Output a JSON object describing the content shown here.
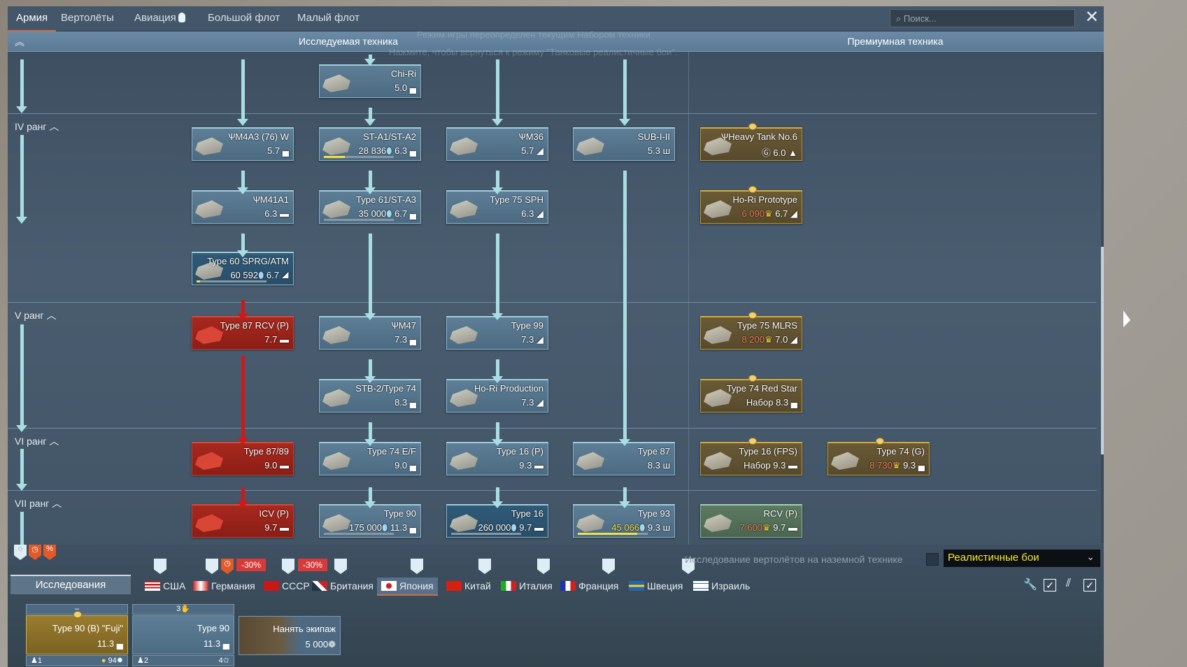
{
  "top_tabs": [
    "Армия",
    "Вертолёты",
    "Авиация",
    "Большой флот",
    "Малый флот"
  ],
  "search": {
    "placeholder": "Поиск..."
  },
  "header": {
    "researched": "Исследуемая техника",
    "premium": "Премиумная техника"
  },
  "notice": {
    "line1": "Режим игры переопределен текущим Набором техники.",
    "line2": "Нажмите, чтобы вернуться к режиму \"Танковые реалистичные бои\"."
  },
  "ranks": [
    "IV ранг",
    "V ранг",
    "VI ранг",
    "VII ранг"
  ],
  "vehicles": [
    {
      "name": "Chi-Ri",
      "br": "5.0",
      "type": "▄",
      "style": "normal"
    },
    {
      "name": "ѰM4A3 (76) W",
      "br": "5.7",
      "type": "▄",
      "style": "normal"
    },
    {
      "name": "ST-A1/ST-A2",
      "cost": "28 836",
      "br": "6.3",
      "type": "▄",
      "style": "normal",
      "progress": 0.3
    },
    {
      "name": "ѰM36",
      "br": "5.7",
      "type": "◢",
      "style": "normal"
    },
    {
      "name": "SUB-I-II",
      "br": "5.3",
      "type": "ш",
      "style": "normal"
    },
    {
      "name": "ѰM41A1",
      "br": "6.3",
      "type": "▬",
      "style": "normal"
    },
    {
      "name": "Type 61/ST-A3",
      "cost": "35 000",
      "br": "6.7",
      "type": "▄",
      "style": "normal",
      "progress": 0
    },
    {
      "name": "Type 75 SPH",
      "br": "6.3",
      "type": "◢",
      "style": "normal"
    },
    {
      "name": "Type 60 SPRG/ATM",
      "cost": "60 592",
      "br": "6.7",
      "type": "◢",
      "style": "sel",
      "progress": 0.05
    },
    {
      "name": "Type 87 RCV (P)",
      "br": "7.7",
      "type": "▬",
      "style": "red"
    },
    {
      "name": "ѰM47",
      "br": "7.3",
      "type": "▄",
      "style": "normal"
    },
    {
      "name": "Type 99",
      "br": "7.3",
      "type": "◢",
      "style": "normal"
    },
    {
      "name": "STB-2/Type 74",
      "br": "8.3",
      "type": "▄",
      "style": "normal"
    },
    {
      "name": "Ho-Ri Production",
      "br": "7.3",
      "type": "◢",
      "style": "normal"
    },
    {
      "name": "Type 87/89",
      "br": "9.0",
      "type": "▬",
      "style": "red"
    },
    {
      "name": "Type 74 E/F",
      "br": "9.0",
      "type": "▄",
      "style": "normal"
    },
    {
      "name": "Type 16 (P)",
      "br": "9.3",
      "type": "▬",
      "style": "normal"
    },
    {
      "name": "Type 87",
      "br": "8.3",
      "type": "ш",
      "style": "normal"
    },
    {
      "name": "ICV (P)",
      "br": "9.7",
      "type": "▬",
      "style": "red"
    },
    {
      "name": "Type 90",
      "cost": "175 000",
      "br": "11.3",
      "type": "▄",
      "style": "normal",
      "progress": 0
    },
    {
      "name": "Type 16",
      "cost": "260 000",
      "br": "9.7",
      "type": "▬",
      "style": "sel",
      "progress": 0
    },
    {
      "name": "Type 93",
      "cost": "45 066",
      "br": "9.3",
      "type": "ш",
      "style": "normal",
      "cost_color": "y",
      "progress": 0.85
    },
    {
      "name": "ѰHeavy Tank No.6",
      "cost": "Ⓖ",
      "br": "6.0",
      "type": "▲",
      "style": "prem"
    },
    {
      "name": "Ho-Ri Prototype",
      "cost": "6 090",
      "br": "6.7",
      "type": "◢",
      "style": "prem",
      "cost_color": "pc"
    },
    {
      "name": "Type 75 MLRS",
      "cost": "8 200",
      "br": "7.0",
      "type": "◢",
      "style": "prem",
      "cost_color": "pc"
    },
    {
      "name": "Type 74 Red Star",
      "cost": "Набор",
      "br": "8.3",
      "type": "▄",
      "style": "prem"
    },
    {
      "name": "Type 16 (FPS)",
      "cost": "Набор",
      "br": "9.3",
      "type": "▬",
      "style": "prem"
    },
    {
      "name": "Type 74 (G)",
      "cost": "8 730",
      "br": "9.3",
      "type": "▄",
      "style": "prem",
      "cost_color": "pc"
    },
    {
      "name": "RCV (P)",
      "cost": "7 600",
      "br": "9.7",
      "type": "▬",
      "style": "green",
      "cost_color": "pc"
    }
  ],
  "bottom": {
    "research_label": "Исследования",
    "discounts": [
      "-30%",
      "-30%"
    ],
    "percent_badge": "%",
    "countries": [
      "США",
      "Германия",
      "СССР",
      "Британия",
      "Япония",
      "Китай",
      "Италия",
      "Франция",
      "Швеция",
      "Израиль"
    ],
    "active_country": "Япония",
    "heli_label": "Исследование вертолётов на наземной технике",
    "mode": "Реалистичные бои",
    "crew": [
      {
        "header": "–",
        "name": "Type 90 (B) \"Fuji\"",
        "br": "11.3",
        "num": "1",
        "level": "94"
      },
      {
        "header": "3",
        "name": "Type 90",
        "br": "11.3",
        "num": "2",
        "level": "4"
      }
    ],
    "hire": {
      "label": "Нанять экипаж",
      "cost": "5 000"
    }
  }
}
